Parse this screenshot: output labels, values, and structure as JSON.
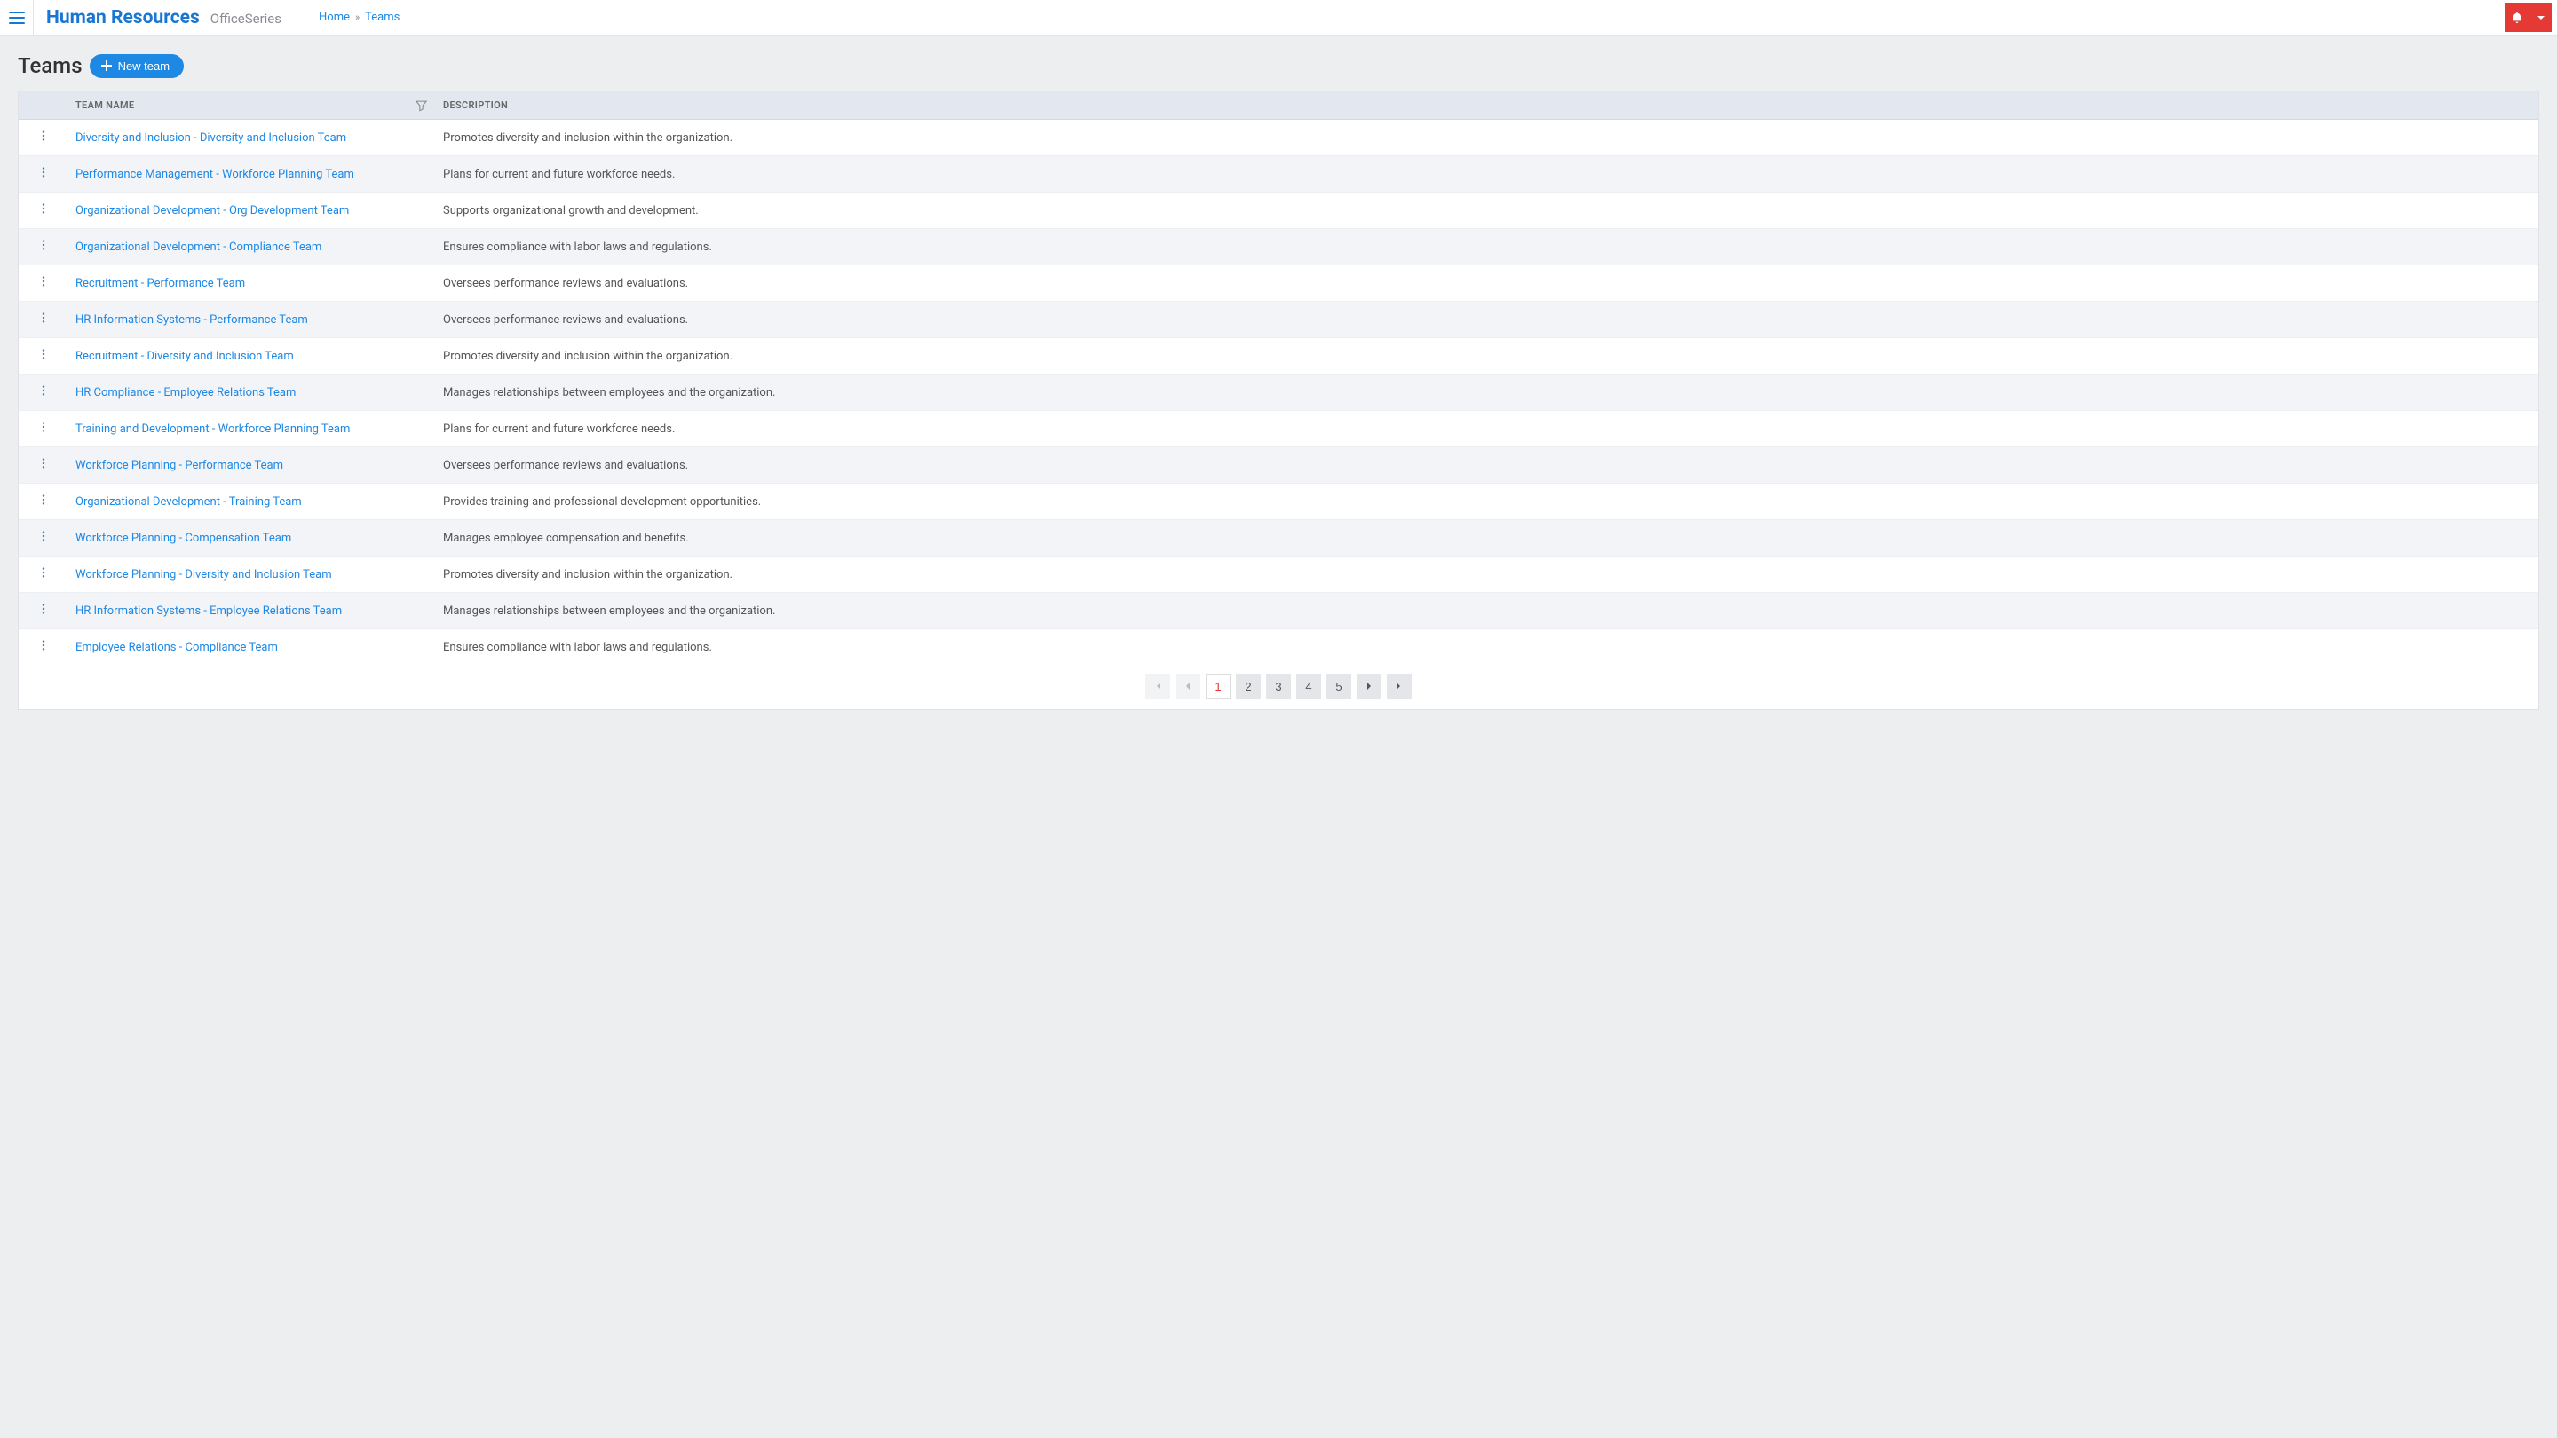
{
  "header": {
    "brand_main": "Human Resources",
    "brand_sub": "OfficeSeries",
    "breadcrumb": {
      "home": "Home",
      "current": "Teams"
    }
  },
  "page": {
    "title": "Teams",
    "new_button": "New team"
  },
  "table": {
    "columns": {
      "name": "Team Name",
      "description": "Description"
    },
    "rows": [
      {
        "name": "Diversity and Inclusion - Diversity and Inclusion Team",
        "description": "Promotes diversity and inclusion within the organization."
      },
      {
        "name": "Performance Management - Workforce Planning Team",
        "description": "Plans for current and future workforce needs."
      },
      {
        "name": "Organizational Development - Org Development Team",
        "description": "Supports organizational growth and development."
      },
      {
        "name": "Organizational Development - Compliance Team",
        "description": "Ensures compliance with labor laws and regulations."
      },
      {
        "name": "Recruitment - Performance Team",
        "description": "Oversees performance reviews and evaluations."
      },
      {
        "name": "HR Information Systems - Performance Team",
        "description": "Oversees performance reviews and evaluations."
      },
      {
        "name": "Recruitment - Diversity and Inclusion Team",
        "description": "Promotes diversity and inclusion within the organization."
      },
      {
        "name": "HR Compliance - Employee Relations Team",
        "description": "Manages relationships between employees and the organization."
      },
      {
        "name": "Training and Development - Workforce Planning Team",
        "description": "Plans for current and future workforce needs."
      },
      {
        "name": "Workforce Planning - Performance Team",
        "description": "Oversees performance reviews and evaluations."
      },
      {
        "name": "Organizational Development - Training Team",
        "description": "Provides training and professional development opportunities."
      },
      {
        "name": "Workforce Planning - Compensation Team",
        "description": "Manages employee compensation and benefits."
      },
      {
        "name": "Workforce Planning - Diversity and Inclusion Team",
        "description": "Promotes diversity and inclusion within the organization."
      },
      {
        "name": "HR Information Systems - Employee Relations Team",
        "description": "Manages relationships between employees and the organization."
      },
      {
        "name": "Employee Relations - Compliance Team",
        "description": "Ensures compliance with labor laws and regulations."
      }
    ]
  },
  "pagination": {
    "pages": [
      "1",
      "2",
      "3",
      "4",
      "5"
    ],
    "current": "1"
  }
}
